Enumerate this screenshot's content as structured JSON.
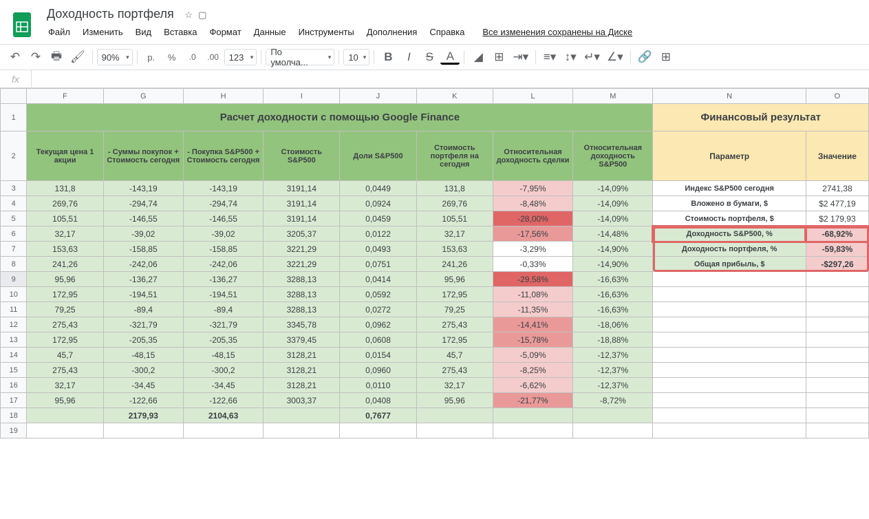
{
  "doc": {
    "title": "Доходность портфеля",
    "saved": "Все изменения сохранены на Диске"
  },
  "menu": [
    "Файл",
    "Изменить",
    "Вид",
    "Вставка",
    "Формат",
    "Данные",
    "Инструменты",
    "Дополнения",
    "Справка"
  ],
  "toolbar": {
    "zoom": "90%",
    "currency": "р.",
    "font": "По умолча...",
    "size": "10"
  },
  "cols": [
    "F",
    "G",
    "H",
    "I",
    "J",
    "K",
    "L",
    "M",
    "N",
    "O"
  ],
  "titles": {
    "green": "Расчет доходности с помощью Google Finance",
    "yellow": "Финансовый результат"
  },
  "headers": {
    "F": "Текущая цена 1 акции",
    "G": "- Суммы покупок + Стоимость сегодня",
    "H": "- Покупка S&P500 + Стоимость сегодня",
    "I": "Стоимость S&P500",
    "J": "Доли S&P500",
    "K": "Стоимость портфеля на сегодня",
    "L": "Относительная доходность сделки",
    "M": "Относительная доходность S&P500",
    "N": "Параметр",
    "O": "Значение"
  },
  "rows": [
    {
      "n": 3,
      "F": "131,8",
      "G": "-143,19",
      "H": "-143,19",
      "I": "3191,14",
      "J": "0,0449",
      "K": "131,8",
      "L": "-7,95%",
      "Lc": "r1",
      "M": "-14,09%"
    },
    {
      "n": 4,
      "F": "269,76",
      "G": "-294,74",
      "H": "-294,74",
      "I": "3191,14",
      "J": "0,0924",
      "K": "269,76",
      "L": "-8,48%",
      "Lc": "r1",
      "M": "-14,09%"
    },
    {
      "n": 5,
      "F": "105,51",
      "G": "-146,55",
      "H": "-146,55",
      "I": "3191,14",
      "J": "0,0459",
      "K": "105,51",
      "L": "-28,00%",
      "Lc": "r3",
      "M": "-14,09%"
    },
    {
      "n": 6,
      "F": "32,17",
      "G": "-39,02",
      "H": "-39,02",
      "I": "3205,37",
      "J": "0,0122",
      "K": "32,17",
      "L": "-17,56%",
      "Lc": "r2",
      "M": "-14,48%"
    },
    {
      "n": 7,
      "F": "153,63",
      "G": "-158,85",
      "H": "-158,85",
      "I": "3221,29",
      "J": "0,0493",
      "K": "153,63",
      "L": "-3,29%",
      "Lc": "w",
      "M": "-14,90%"
    },
    {
      "n": 8,
      "F": "241,26",
      "G": "-242,06",
      "H": "-242,06",
      "I": "3221,29",
      "J": "0,0751",
      "K": "241,26",
      "L": "-0,33%",
      "Lc": "w",
      "M": "-14,90%"
    },
    {
      "n": 9,
      "F": "95,96",
      "G": "-136,27",
      "H": "-136,27",
      "I": "3288,13",
      "J": "0,0414",
      "K": "95,96",
      "L": "-29,58%",
      "Lc": "r3",
      "M": "-16,63%"
    },
    {
      "n": 10,
      "F": "172,95",
      "G": "-194,51",
      "H": "-194,51",
      "I": "3288,13",
      "J": "0,0592",
      "K": "172,95",
      "L": "-11,08%",
      "Lc": "r1",
      "M": "-16,63%"
    },
    {
      "n": 11,
      "F": "79,25",
      "G": "-89,4",
      "H": "-89,4",
      "I": "3288,13",
      "J": "0,0272",
      "K": "79,25",
      "L": "-11,35%",
      "Lc": "r1",
      "M": "-16,63%"
    },
    {
      "n": 12,
      "F": "275,43",
      "G": "-321,79",
      "H": "-321,79",
      "I": "3345,78",
      "J": "0,0962",
      "K": "275,43",
      "L": "-14,41%",
      "Lc": "r2",
      "M": "-18,06%"
    },
    {
      "n": 13,
      "F": "172,95",
      "G": "-205,35",
      "H": "-205,35",
      "I": "3379,45",
      "J": "0,0608",
      "K": "172,95",
      "L": "-15,78%",
      "Lc": "r2",
      "M": "-18,88%"
    },
    {
      "n": 14,
      "F": "45,7",
      "G": "-48,15",
      "H": "-48,15",
      "I": "3128,21",
      "J": "0,0154",
      "K": "45,7",
      "L": "-5,09%",
      "Lc": "r1",
      "M": "-12,37%"
    },
    {
      "n": 15,
      "F": "275,43",
      "G": "-300,2",
      "H": "-300,2",
      "I": "3128,21",
      "J": "0,0960",
      "K": "275,43",
      "L": "-8,25%",
      "Lc": "r1",
      "M": "-12,37%"
    },
    {
      "n": 16,
      "F": "32,17",
      "G": "-34,45",
      "H": "-34,45",
      "I": "3128,21",
      "J": "0,0110",
      "K": "32,17",
      "L": "-6,62%",
      "Lc": "r1",
      "M": "-12,37%"
    },
    {
      "n": 17,
      "F": "95,96",
      "G": "-122,66",
      "H": "-122,66",
      "I": "3003,37",
      "J": "0,0408",
      "K": "95,96",
      "L": "-21,77%",
      "Lc": "r2",
      "M": "-8,72%"
    }
  ],
  "sum": {
    "n": 18,
    "G": "2179,93",
    "H": "2104,63",
    "J": "0,7677"
  },
  "results": [
    {
      "p": "Индекс S&P500 сегодня",
      "v": "2741,38",
      "hl": false
    },
    {
      "p": "Вложено в бумаги, $",
      "v": "$2 477,19",
      "hl": false
    },
    {
      "p": "Стоимость портфеля, $",
      "v": "$2 179,93",
      "hl": false
    },
    {
      "p": "Доходность S&P500, %",
      "v": "-68,92%",
      "hl": true
    },
    {
      "p": "Доходность портфеля, %",
      "v": "-59,83%",
      "hl": true
    },
    {
      "p": "Общая прибыль, $",
      "v": "-$297,26",
      "hl": true
    }
  ]
}
